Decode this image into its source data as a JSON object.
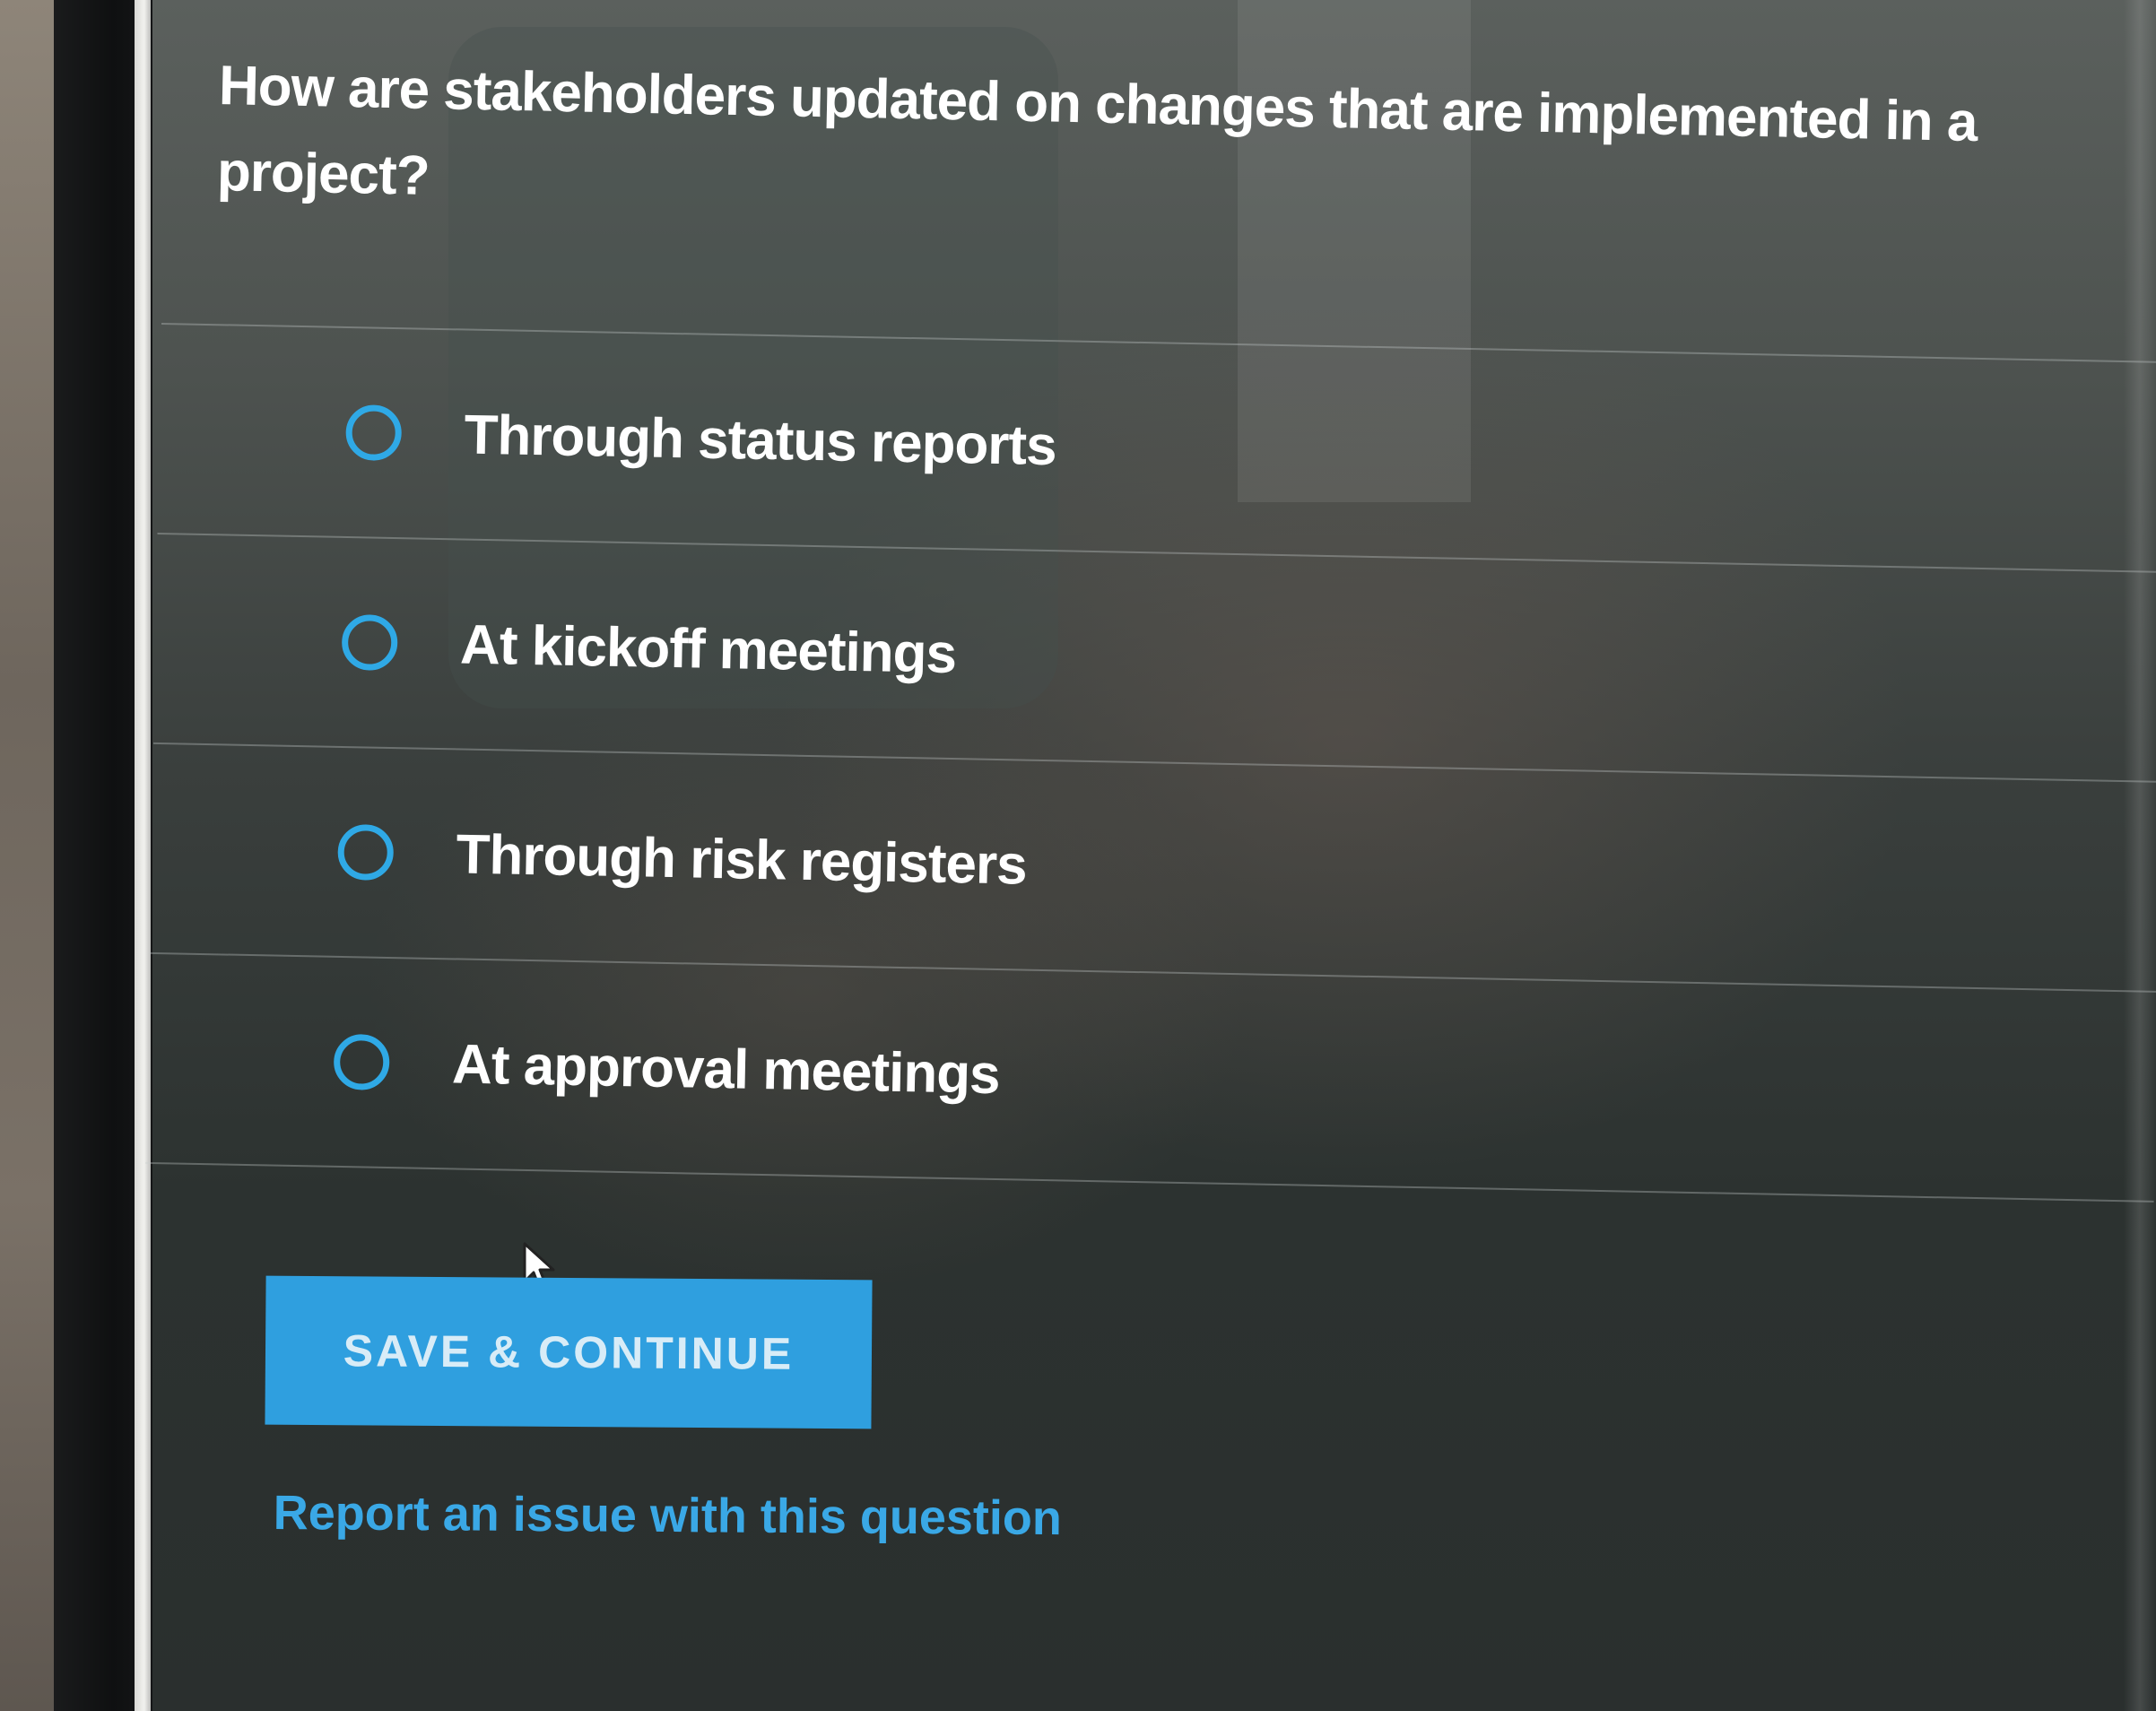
{
  "quiz": {
    "question": "How are stakeholders updated on changes that are implemented in a project?",
    "options": [
      {
        "label": "Through status reports",
        "selected": false
      },
      {
        "label": "At kickoff meetings",
        "selected": false
      },
      {
        "label": "Through risk registers",
        "selected": false
      },
      {
        "label": "At approval meetings",
        "selected": false
      }
    ],
    "save_button_label": "SAVE & CONTINUE",
    "report_link": "Report an issue with this question"
  },
  "colors": {
    "accent": "#2f9fdf",
    "radio_ring": "#2fa9e6",
    "link": "#3aa8e6",
    "text": "#ffffff"
  },
  "icons": {
    "radio": "radio-unselected-icon",
    "cursor": "mouse-pointer-icon"
  }
}
